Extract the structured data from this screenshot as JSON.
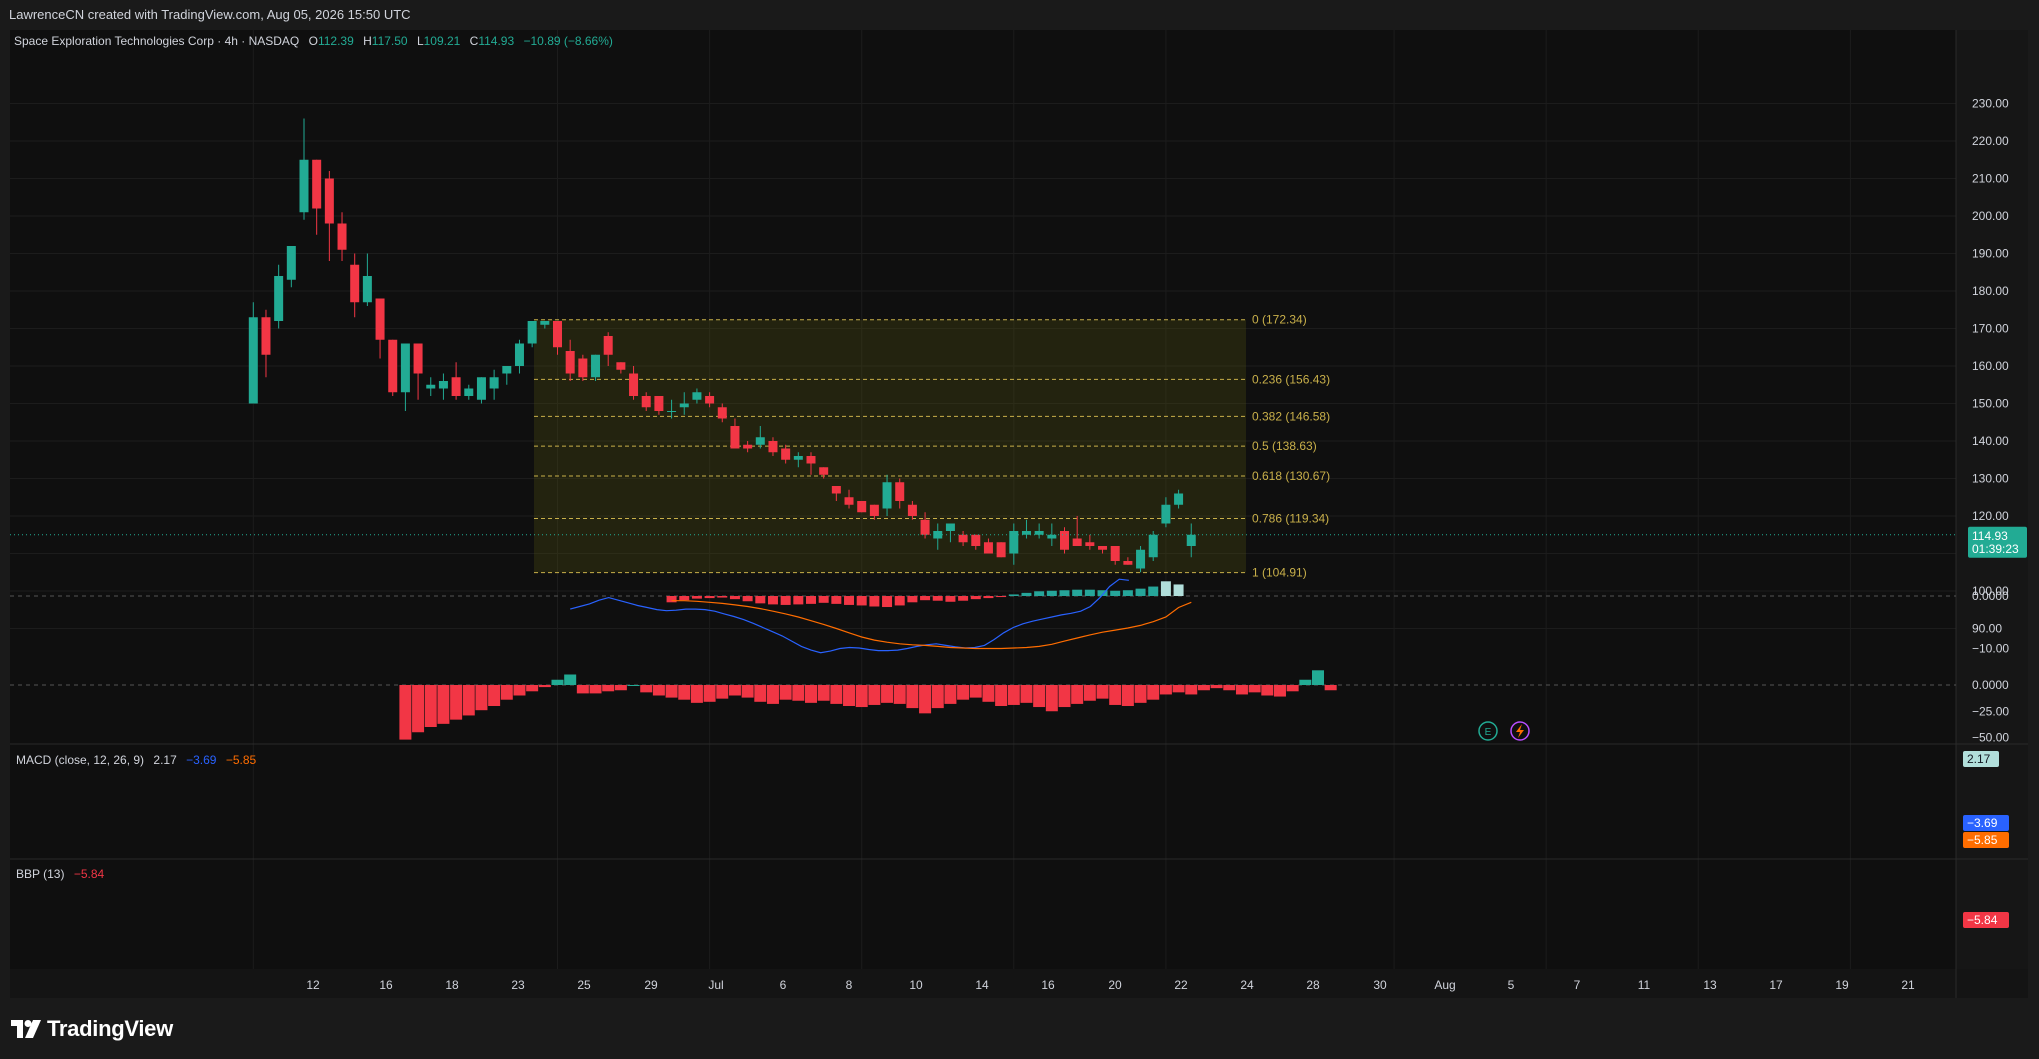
{
  "attribution": "LawrenceCN created with TradingView.com, Aug 05, 2026 15:50 UTC",
  "brand": "TradingView",
  "brand_icon": "tradingview-logo-icon",
  "legend": {
    "title": "Space Exploration Technologies Corp · 4h · NASDAQ",
    "o_key": "O",
    "o_val": "112.39",
    "h_key": "H",
    "h_val": "117.50",
    "l_key": "L",
    "l_val": "109.21",
    "c_key": "C",
    "c_val": "114.93",
    "change": "−10.89 (−8.66%)"
  },
  "last_price": {
    "value": "114.93",
    "countdown": "01:39:23"
  },
  "macd": {
    "label": "MACD (close, 12, 26, 9)",
    "hist": "2.17",
    "macd": "−3.69",
    "signal": "−5.85"
  },
  "bbp": {
    "label": "BBP (13)",
    "value": "−5.84"
  },
  "icons": {
    "earnings": "earnings-icon",
    "dividend": "event-lightning-icon",
    "earnings_letter": "E"
  },
  "colors": {
    "up": "#22ab94",
    "down": "#f23645",
    "bg": "#0f0f0f",
    "fib": "#c9b04a",
    "macd_line": "#2962ff",
    "signal_line": "#ff6d00",
    "hist_light": "#b2dfdb",
    "hist_dark": "#26a69a"
  },
  "chart_data": {
    "type": "candlestick",
    "interval": "4h",
    "price_axis_ticks": [
      "230.00",
      "220.00",
      "210.00",
      "200.00",
      "190.00",
      "180.00",
      "170.00",
      "160.00",
      "150.00",
      "140.00",
      "130.00",
      "120.00",
      "110.00",
      "100.00",
      "90.00"
    ],
    "macd_axis_ticks": [
      "0.0000",
      "−10.00"
    ],
    "bbp_axis_ticks": [
      "0.0000",
      "−25.00",
      "−50.00"
    ],
    "time_axis_labels": [
      "12",
      "16",
      "18",
      "23",
      "25",
      "29",
      "Jul",
      "6",
      "8",
      "10",
      "14",
      "16",
      "20",
      "22",
      "24",
      "28",
      "30",
      "Aug",
      "5",
      "7",
      "11",
      "13",
      "17",
      "19",
      "21"
    ],
    "fib_levels": [
      {
        "label": "0 (172.34)",
        "value": 172.34
      },
      {
        "label": "0.236 (156.43)",
        "value": 156.43
      },
      {
        "label": "0.382 (146.58)",
        "value": 146.58
      },
      {
        "label": "0.5 (138.63)",
        "value": 138.63
      },
      {
        "label": "0.618 (130.67)",
        "value": 130.67
      },
      {
        "label": "0.786 (119.34)",
        "value": 119.34
      },
      {
        "label": "1 (104.91)",
        "value": 104.91
      }
    ],
    "candles": [
      {
        "o": 150,
        "h": 177,
        "l": 150,
        "c": 173
      },
      {
        "o": 173,
        "h": 175,
        "l": 157,
        "c": 163
      },
      {
        "o": 172,
        "h": 187,
        "l": 170,
        "c": 184
      },
      {
        "o": 183,
        "h": 191,
        "l": 181,
        "c": 192
      },
      {
        "o": 201,
        "h": 226,
        "l": 199,
        "c": 215
      },
      {
        "o": 215,
        "h": 215,
        "l": 195,
        "c": 202
      },
      {
        "o": 210,
        "h": 212,
        "l": 188,
        "c": 198
      },
      {
        "o": 198,
        "h": 201,
        "l": 188,
        "c": 191
      },
      {
        "o": 187,
        "h": 190,
        "l": 173,
        "c": 177
      },
      {
        "o": 177,
        "h": 190,
        "l": 176,
        "c": 184
      },
      {
        "o": 178,
        "h": 178,
        "l": 162,
        "c": 167
      },
      {
        "o": 167,
        "h": 167,
        "l": 152,
        "c": 153
      },
      {
        "o": 153,
        "h": 166,
        "l": 148,
        "c": 166
      },
      {
        "o": 166,
        "h": 166,
        "l": 151,
        "c": 158
      },
      {
        "o": 154,
        "h": 157,
        "l": 152,
        "c": 155
      },
      {
        "o": 154,
        "h": 158,
        "l": 151,
        "c": 156
      },
      {
        "o": 157,
        "h": 161,
        "l": 151,
        "c": 152
      },
      {
        "o": 152,
        "h": 155,
        "l": 151,
        "c": 154
      },
      {
        "o": 151,
        "h": 157,
        "l": 150,
        "c": 157
      },
      {
        "o": 154,
        "h": 159,
        "l": 151,
        "c": 157
      },
      {
        "o": 158,
        "h": 160,
        "l": 155,
        "c": 160
      },
      {
        "o": 160,
        "h": 167,
        "l": 158,
        "c": 166
      },
      {
        "o": 166,
        "h": 172,
        "l": 165,
        "c": 172
      },
      {
        "o": 171,
        "h": 172,
        "l": 170,
        "c": 172
      },
      {
        "o": 172,
        "h": 172,
        "l": 163,
        "c": 165
      },
      {
        "o": 164,
        "h": 167,
        "l": 156,
        "c": 158
      },
      {
        "o": 162,
        "h": 163,
        "l": 156,
        "c": 157
      },
      {
        "o": 157,
        "h": 163,
        "l": 156,
        "c": 163
      },
      {
        "o": 168,
        "h": 169,
        "l": 160,
        "c": 163
      },
      {
        "o": 161,
        "h": 161,
        "l": 158,
        "c": 159
      },
      {
        "o": 158,
        "h": 160,
        "l": 151,
        "c": 152
      },
      {
        "o": 152,
        "h": 153,
        "l": 148,
        "c": 149
      },
      {
        "o": 152,
        "h": 152,
        "l": 147,
        "c": 148
      },
      {
        "o": 148,
        "h": 151,
        "l": 146,
        "c": 148
      },
      {
        "o": 149,
        "h": 153,
        "l": 147,
        "c": 150
      },
      {
        "o": 151,
        "h": 154,
        "l": 150,
        "c": 153
      },
      {
        "o": 152,
        "h": 153,
        "l": 149,
        "c": 150
      },
      {
        "o": 149,
        "h": 150,
        "l": 145,
        "c": 146
      },
      {
        "o": 144,
        "h": 146,
        "l": 138,
        "c": 138
      },
      {
        "o": 139,
        "h": 140,
        "l": 137,
        "c": 138
      },
      {
        "o": 139,
        "h": 144,
        "l": 138,
        "c": 141
      },
      {
        "o": 140,
        "h": 141,
        "l": 136,
        "c": 137
      },
      {
        "o": 138,
        "h": 139,
        "l": 134,
        "c": 135
      },
      {
        "o": 135,
        "h": 137,
        "l": 133,
        "c": 136
      },
      {
        "o": 136,
        "h": 137,
        "l": 131,
        "c": 134
      },
      {
        "o": 133,
        "h": 133,
        "l": 130,
        "c": 131
      },
      {
        "o": 128,
        "h": 128,
        "l": 124,
        "c": 126
      },
      {
        "o": 125,
        "h": 127,
        "l": 122,
        "c": 123
      },
      {
        "o": 124,
        "h": 124,
        "l": 121,
        "c": 121
      },
      {
        "o": 123,
        "h": 123,
        "l": 119,
        "c": 120
      },
      {
        "o": 122,
        "h": 131,
        "l": 120,
        "c": 129
      },
      {
        "o": 129,
        "h": 130,
        "l": 122,
        "c": 124
      },
      {
        "o": 123,
        "h": 124,
        "l": 119,
        "c": 120
      },
      {
        "o": 119,
        "h": 121,
        "l": 114,
        "c": 115
      },
      {
        "o": 114,
        "h": 118,
        "l": 111,
        "c": 116
      },
      {
        "o": 116,
        "h": 118,
        "l": 113,
        "c": 118
      },
      {
        "o": 115,
        "h": 116,
        "l": 112,
        "c": 113
      },
      {
        "o": 115,
        "h": 115,
        "l": 111,
        "c": 112
      },
      {
        "o": 113,
        "h": 114,
        "l": 110,
        "c": 110
      },
      {
        "o": 113,
        "h": 113,
        "l": 109,
        "c": 109
      },
      {
        "o": 110,
        "h": 118,
        "l": 107,
        "c": 116
      },
      {
        "o": 115,
        "h": 119,
        "l": 114,
        "c": 116
      },
      {
        "o": 115,
        "h": 118,
        "l": 114,
        "c": 116
      },
      {
        "o": 114,
        "h": 118,
        "l": 112,
        "c": 115
      },
      {
        "o": 116,
        "h": 117,
        "l": 110,
        "c": 111
      },
      {
        "o": 114,
        "h": 120,
        "l": 113,
        "c": 112
      },
      {
        "o": 113,
        "h": 115,
        "l": 111,
        "c": 112
      },
      {
        "o": 112,
        "h": 112,
        "l": 110,
        "c": 111
      },
      {
        "o": 112,
        "h": 112,
        "l": 107,
        "c": 108
      },
      {
        "o": 108,
        "h": 109,
        "l": 107,
        "c": 107
      },
      {
        "o": 106,
        "h": 112,
        "l": 105,
        "c": 111
      },
      {
        "o": 109,
        "h": 116,
        "l": 108,
        "c": 115
      },
      {
        "o": 118,
        "h": 125,
        "l": 117,
        "c": 123
      },
      {
        "o": 123,
        "h": 127,
        "l": 122,
        "c": 126
      },
      {
        "o": 112,
        "h": 118,
        "l": 109,
        "c": 115
      }
    ],
    "macd_hist": [
      -1.2,
      -0.8,
      -0.5,
      -0.4,
      -0.3,
      -0.6,
      -1.0,
      -1.4,
      -1.6,
      -1.7,
      -1.6,
      -1.5,
      -1.3,
      -1.5,
      -1.7,
      -1.8,
      -2.0,
      -2.1,
      -1.8,
      -1.2,
      -0.8,
      -0.9,
      -1.1,
      -0.9,
      -0.6,
      -0.4,
      -0.2,
      0.3,
      0.6,
      0.9,
      1.0,
      1.1,
      1.2,
      1.2,
      1.1,
      1.0,
      1.1,
      1.4,
      1.8,
      2.8,
      2.2
    ],
    "macd_hist_start": 33,
    "macd_line": [
      -2.5,
      -2.0,
      -1.5,
      -0.8,
      -0.3,
      -0.8,
      -1.3,
      -1.8,
      -2.2,
      -2.6,
      -2.8,
      -2.7,
      -2.5,
      -2.5,
      -2.6,
      -2.9,
      -3.4,
      -3.9,
      -4.5,
      -5.2,
      -6.0,
      -6.8,
      -7.6,
      -8.6,
      -9.6,
      -10.3,
      -10.8,
      -10.5,
      -10.0,
      -9.8,
      -9.9,
      -10.2,
      -10.4,
      -10.4,
      -10.3,
      -10.0,
      -9.6,
      -9.3,
      -9.1,
      -9.4,
      -9.7,
      -9.9,
      -9.8,
      -9.4,
      -8.3,
      -7.0,
      -6.0,
      -5.3,
      -4.8,
      -4.4,
      -4.0,
      -3.6,
      -3.3,
      -2.9,
      -2.0,
      -0.3,
      1.8,
      3.2,
      3.0
    ],
    "macd_line_start": 16,
    "signal_line": [
      -0.9,
      -0.9,
      -1.0,
      -1.2,
      -1.4,
      -1.7,
      -2.0,
      -2.4,
      -2.9,
      -3.4,
      -4.0,
      -4.7,
      -5.4,
      -6.2,
      -7.0,
      -7.8,
      -8.4,
      -8.8,
      -9.1,
      -9.3,
      -9.4,
      -9.6,
      -9.8,
      -9.9,
      -10.0,
      -10.0,
      -10.0,
      -9.9,
      -9.8,
      -9.6,
      -9.2,
      -8.6,
      -8.0,
      -7.4,
      -6.9,
      -6.5,
      -6.1,
      -5.6,
      -4.9,
      -4.0,
      -2.2,
      -1.2
    ],
    "signal_line_start": 32,
    "bbp_values": [
      -52,
      -45,
      -40,
      -37,
      -33,
      -29,
      -24,
      -20,
      -14,
      -10,
      -6,
      -2,
      5,
      10,
      -8,
      -8,
      -6,
      -5,
      0,
      -7,
      -10,
      -12,
      -14,
      -17,
      -16,
      -13,
      -10,
      -12,
      -16,
      -18,
      -14,
      -15,
      -17,
      -15,
      -18,
      -20,
      -21,
      -19,
      -17,
      -18,
      -22,
      -27,
      -22,
      -18,
      -14,
      -12,
      -16,
      -20,
      -19,
      -17,
      -21,
      -25,
      -21,
      -18,
      -15,
      -13,
      -19,
      -20,
      -17,
      -14,
      -9,
      -7,
      -9,
      -5,
      -3,
      -5,
      -9,
      -7,
      -10,
      -11,
      -6,
      5,
      14,
      -5
    ],
    "bbp_start": 12
  }
}
